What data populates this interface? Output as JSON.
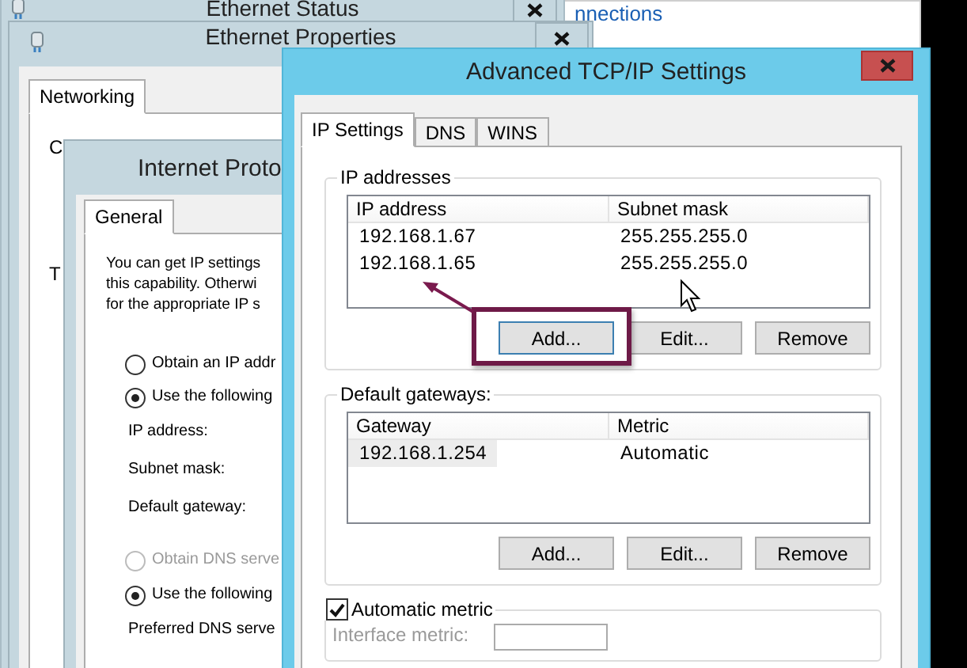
{
  "background_window": {
    "text": "nnections"
  },
  "status_window": {
    "title": "Ethernet Status"
  },
  "properties_window": {
    "title": "Ethernet Properties",
    "tabs": [
      {
        "label": "Networking",
        "selected": true
      }
    ],
    "labels": [
      "C",
      "T"
    ]
  },
  "ipv4_window": {
    "title": "Internet Proto",
    "tabs": [
      {
        "label": "General",
        "selected": true
      }
    ],
    "intro": [
      "You can get IP settings",
      "this capability. Otherwi",
      "for the appropriate IP s"
    ],
    "ip_options": [
      {
        "label": "Obtain an IP addr",
        "selected": false,
        "disabled": false
      },
      {
        "label": "Use the following",
        "selected": true,
        "disabled": false
      }
    ],
    "ip_fields": [
      "IP address:",
      "Subnet mask:",
      "Default gateway:"
    ],
    "dns_options": [
      {
        "label": "Obtain DNS serve",
        "selected": false,
        "disabled": true
      },
      {
        "label": "Use the following",
        "selected": true,
        "disabled": false
      }
    ],
    "dns_fields": [
      "Preferred DNS serve"
    ]
  },
  "advanced_window": {
    "title": "Advanced TCP/IP Settings",
    "tabs": [
      {
        "label": "IP Settings",
        "selected": true
      },
      {
        "label": "DNS",
        "selected": false
      },
      {
        "label": "WINS",
        "selected": false
      }
    ],
    "ip_addresses": {
      "label": "IP addresses",
      "columns": [
        "IP address",
        "Subnet mask"
      ],
      "rows": [
        {
          "cells": [
            "192.168.1.67",
            "255.255.255.0"
          ],
          "selected": false
        },
        {
          "cells": [
            "192.168.1.65",
            "255.255.255.0"
          ],
          "selected": false
        }
      ],
      "buttons": [
        "Add...",
        "Edit...",
        "Remove"
      ]
    },
    "default_gateways": {
      "label": "Default gateways:",
      "columns": [
        "Gateway",
        "Metric"
      ],
      "rows": [
        {
          "cells": [
            "192.168.1.254",
            "Automatic"
          ],
          "selected": true
        }
      ],
      "buttons": [
        "Add...",
        "Edit...",
        "Remove"
      ]
    },
    "automatic_metric": {
      "label": "Automatic metric",
      "checked": true
    },
    "interface_metric": {
      "label": "Interface metric:",
      "disabled": true
    }
  }
}
